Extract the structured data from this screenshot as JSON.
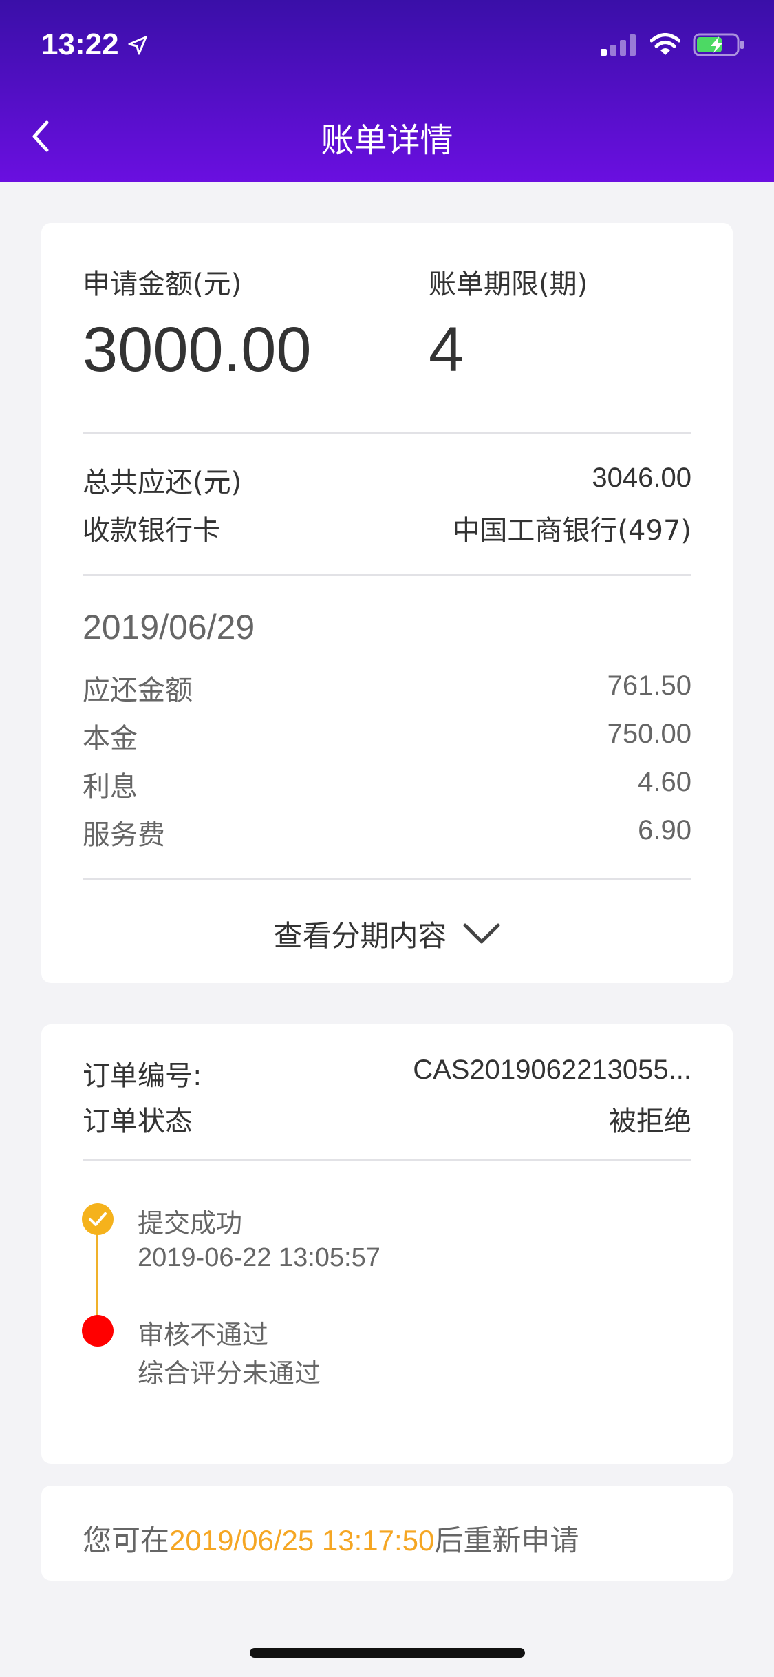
{
  "status_bar": {
    "time": "13:22"
  },
  "nav": {
    "title": "账单详情"
  },
  "summary": {
    "amount_label": "申请金额(元)",
    "amount_value": "3000.00",
    "term_label": "账单期限(期)",
    "term_value": "4",
    "total_label": "总共应还(元)",
    "total_value": "3046.00",
    "bank_label": "收款银行卡",
    "bank_value": "中国工商银行(497)"
  },
  "installment": {
    "date": "2019/06/29",
    "rows": [
      {
        "label": "应还金额",
        "value": "761.50"
      },
      {
        "label": "本金",
        "value": "750.00"
      },
      {
        "label": "利息",
        "value": "4.60"
      },
      {
        "label": "服务费",
        "value": "6.90"
      }
    ],
    "expand_label": "查看分期内容"
  },
  "order": {
    "number_label": "订单编号:",
    "number_value": "CAS2019062213055...",
    "status_label": "订单状态",
    "status_value": "被拒绝",
    "timeline": [
      {
        "title": "提交成功",
        "detail": "2019-06-22 13:05:57",
        "color": "#f5b21c"
      },
      {
        "title": "审核不通过",
        "detail": "综合评分未通过",
        "color": "#ff0000"
      }
    ]
  },
  "notice": {
    "prefix": "您可在",
    "highlight": "2019/06/25 13:17:50",
    "suffix": "后重新申请",
    "highlight_color": "#f5a623"
  },
  "colors": {
    "header_start": "#3a0fa8",
    "header_end": "#6a0fe0"
  }
}
